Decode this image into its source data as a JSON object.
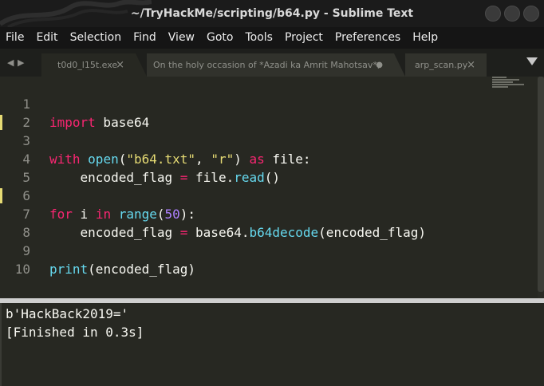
{
  "window": {
    "title": "~/TryHackMe/scripting/b64.py - Sublime Text"
  },
  "menu": [
    "File",
    "Edit",
    "Selection",
    "Find",
    "View",
    "Goto",
    "Tools",
    "Project",
    "Preferences",
    "Help"
  ],
  "tabs": [
    {
      "label": "t0d0_l15t.exe",
      "state": "close"
    },
    {
      "label": "On the holy occasion of *Azadi ka Amrit Mahotsav*,",
      "state": "modified"
    },
    {
      "label": "arp_scan.py",
      "state": "close"
    }
  ],
  "tab_icons": {
    "close": "×",
    "modified": "●",
    "prev": "◀",
    "next": "▶"
  },
  "editor": {
    "line_numbers": [
      "1",
      "2",
      "3",
      "4",
      "5",
      "6",
      "7",
      "8",
      "9",
      "10"
    ],
    "lines": {
      "l1": {
        "kw": "import",
        "rest": " base64"
      },
      "l3": {
        "kw": "with",
        "sp1": " ",
        "fn": "open",
        "p1": "(",
        "s1": "\"b64.txt\"",
        "c1": ", ",
        "s2": "\"r\"",
        "p2": ") ",
        "kw2": "as",
        "rest": " file:"
      },
      "l4": {
        "a": "    encoded_flag ",
        "op": "=",
        "b": " file.",
        "fn": "read",
        "c": "()"
      },
      "l6": {
        "kw": "for",
        "a": " i ",
        "kw2": "in",
        "sp": " ",
        "fn": "range",
        "p1": "(",
        "num": "50",
        "p2": "):"
      },
      "l7": {
        "a": "    encoded_flag ",
        "op": "=",
        "b": " base64.",
        "fn": "b64decode",
        "c": "(encoded_flag)"
      },
      "l9": {
        "fn": "print",
        "c": "(encoded_flag)"
      }
    }
  },
  "output": {
    "lines": [
      "b'HackBack2019='",
      "[Finished in 0.3s]"
    ]
  },
  "colors": {
    "editor_bg": "#272822",
    "keyword": "#f92672",
    "function": "#66d9ef",
    "string": "#e6db74",
    "number": "#ae81ff",
    "modified_marker": "#e6db74"
  }
}
